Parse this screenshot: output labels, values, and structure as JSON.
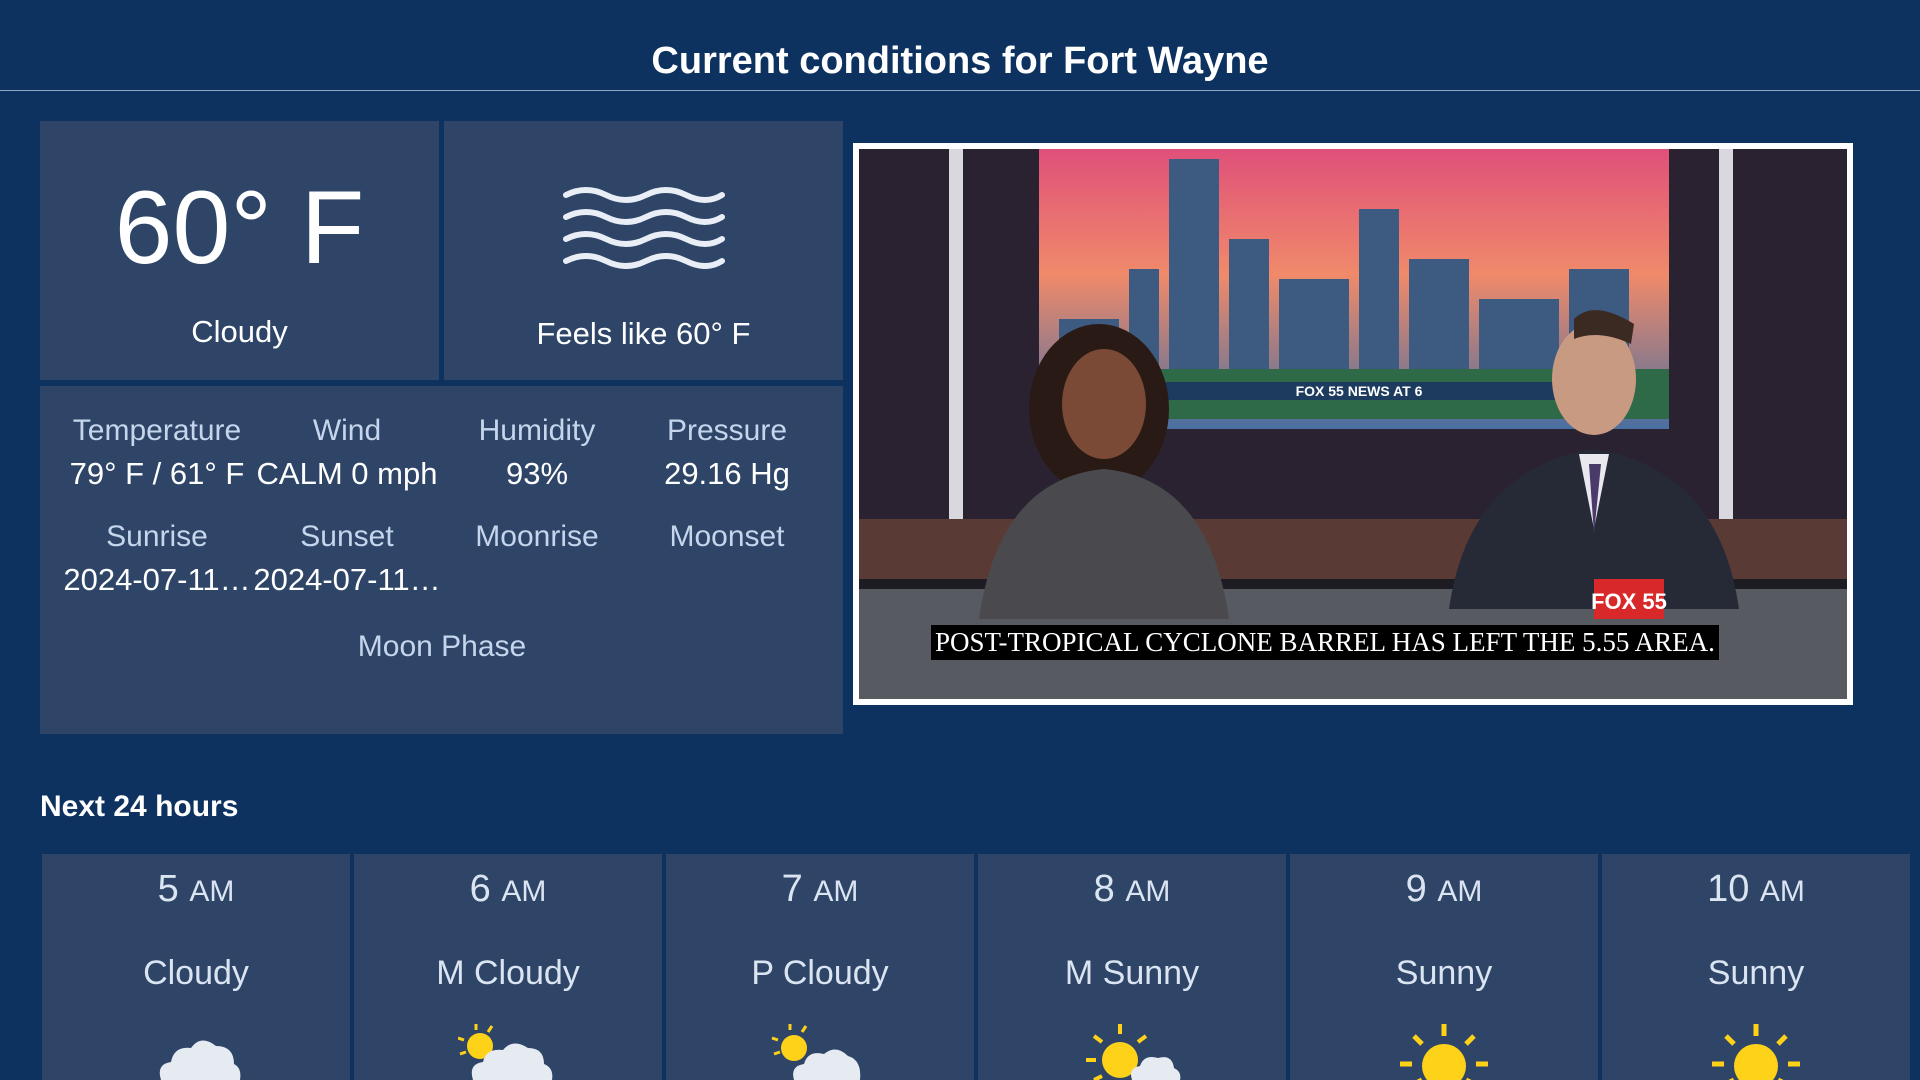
{
  "header": {
    "title": "Current conditions for Fort Wayne"
  },
  "current": {
    "temperature": "60° F",
    "condition": "Cloudy",
    "feels_like": "Feels like 60° F",
    "feels_icon": "fog-waves-icon"
  },
  "details": [
    {
      "label": "Temperature",
      "value": "79° F  / 61° F"
    },
    {
      "label": "Wind",
      "value": "CALM 0 mph"
    },
    {
      "label": "Humidity",
      "value": "93%"
    },
    {
      "label": "Pressure",
      "value": "29.16 Hg"
    },
    {
      "label": "Sunrise",
      "value": "2024-07-11…"
    },
    {
      "label": "Sunset",
      "value": "2024-07-11…"
    },
    {
      "label": "Moonrise",
      "value": ""
    },
    {
      "label": "Moonset",
      "value": ""
    },
    {
      "label": "Moon Phase",
      "value": ""
    }
  ],
  "video": {
    "caption": "POST-TROPICAL CYCLONE BARREL HAS LEFT THE 5.55 AREA.",
    "ticker": "FOX 55 NEWS AT 6",
    "logo": "FOX 55"
  },
  "forecast": {
    "title": "Next 24 hours",
    "hours": [
      {
        "hour": "5",
        "ampm": "AM",
        "condition": "Cloudy",
        "icon": "cloud-icon"
      },
      {
        "hour": "6",
        "ampm": "AM",
        "condition": "M Cloudy",
        "icon": "sun-behind-cloud-icon"
      },
      {
        "hour": "7",
        "ampm": "AM",
        "condition": "P Cloudy",
        "icon": "sun-behind-cloud-icon"
      },
      {
        "hour": "8",
        "ampm": "AM",
        "condition": "M Sunny",
        "icon": "sun-small-cloud-icon"
      },
      {
        "hour": "9",
        "ampm": "AM",
        "condition": "Sunny",
        "icon": "sun-icon"
      },
      {
        "hour": "10",
        "ampm": "AM",
        "condition": "Sunny",
        "icon": "sun-icon"
      }
    ]
  },
  "colors": {
    "background": "#0e3260",
    "panel": "#2e4568",
    "label": "#c5d6ec",
    "sun": "#ffd21a"
  }
}
